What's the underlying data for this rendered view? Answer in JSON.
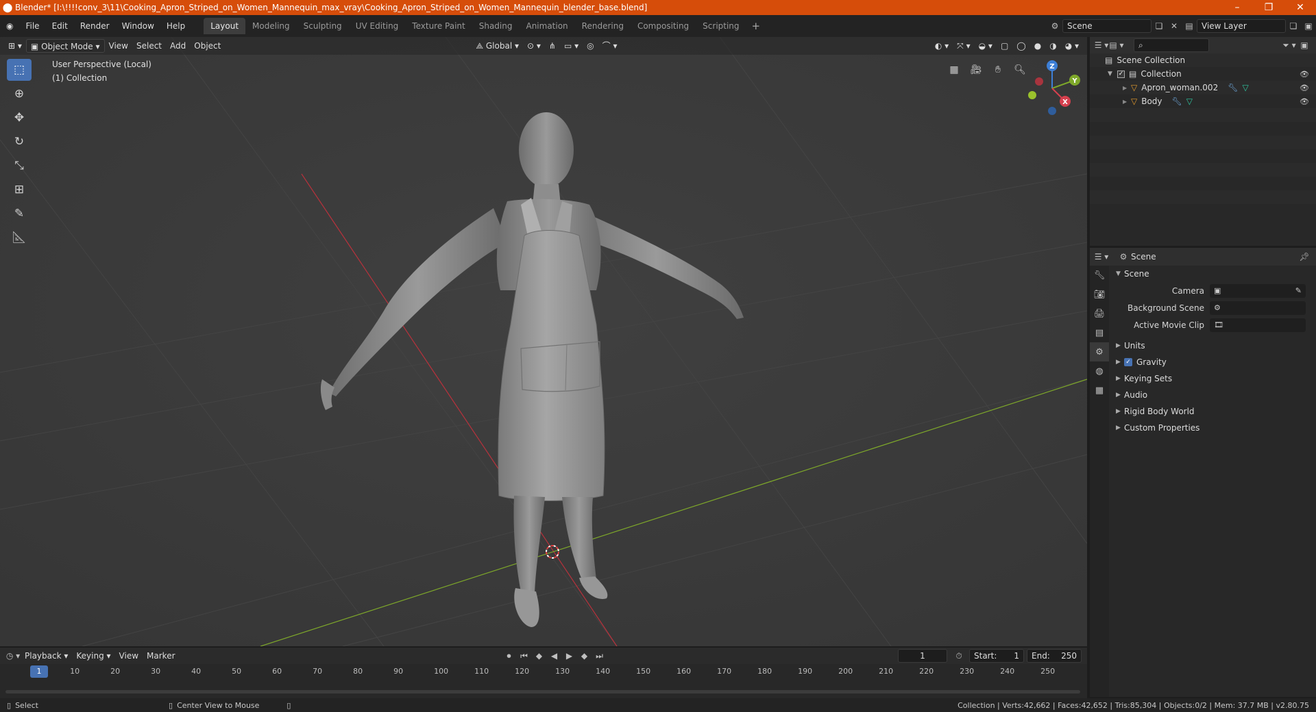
{
  "window": {
    "title": "Blender* [I:\\!!!!conv_3\\11\\Cooking_Apron_Striped_on_Women_Mannequin_max_vray\\Cooking_Apron_Striped_on_Women_Mannequin_blender_base.blend]"
  },
  "menu": [
    "File",
    "Edit",
    "Render",
    "Window",
    "Help"
  ],
  "workspaces": [
    "Layout",
    "Modeling",
    "Sculpting",
    "UV Editing",
    "Texture Paint",
    "Shading",
    "Animation",
    "Rendering",
    "Compositing",
    "Scripting"
  ],
  "active_workspace": "Layout",
  "scene_field": "Scene",
  "view_layer_field": "View Layer",
  "viewport": {
    "mode": "Object Mode",
    "menus": [
      "View",
      "Select",
      "Add",
      "Object"
    ],
    "transform": "Global",
    "info_line1": "User Perspective (Local)",
    "info_line2": "(1) Collection",
    "gizmo": {
      "z": "Z",
      "y": "Y",
      "x": "X"
    },
    "colors": {
      "x_axis": "#b8323c",
      "y_axis": "#7ea82a",
      "background": "#3d3d3d",
      "active_tool": "#4772b3"
    }
  },
  "outliner": {
    "root": "Scene Collection",
    "collection": "Collection",
    "objects": [
      "Apron_woman.002",
      "Body"
    ]
  },
  "properties": {
    "header": "Scene",
    "section": "Scene",
    "props": [
      {
        "label": "Camera"
      },
      {
        "label": "Background Scene"
      },
      {
        "label": "Active Movie Clip"
      }
    ],
    "subsections": [
      "Units",
      "Gravity",
      "Keying Sets",
      "Audio",
      "Rigid Body World",
      "Custom Properties"
    ]
  },
  "timeline": {
    "menus": [
      "Playback",
      "Keying",
      "View",
      "Marker"
    ],
    "current_frame": "1",
    "start_label": "Start:",
    "start": "1",
    "end_label": "End:",
    "end": "250",
    "ticks": [
      "10",
      "20",
      "30",
      "40",
      "50",
      "60",
      "70",
      "80",
      "90",
      "100",
      "110",
      "120",
      "130",
      "140",
      "150",
      "160",
      "170",
      "180",
      "190",
      "200",
      "210",
      "220",
      "230",
      "240",
      "250"
    ]
  },
  "statusbar": {
    "select": "Select",
    "center": "Center View to Mouse",
    "stats": "Collection | Verts:42,662 | Faces:42,652 | Tris:85,304 | Objects:0/2 | Mem: 37.7 MB | v2.80.75"
  }
}
